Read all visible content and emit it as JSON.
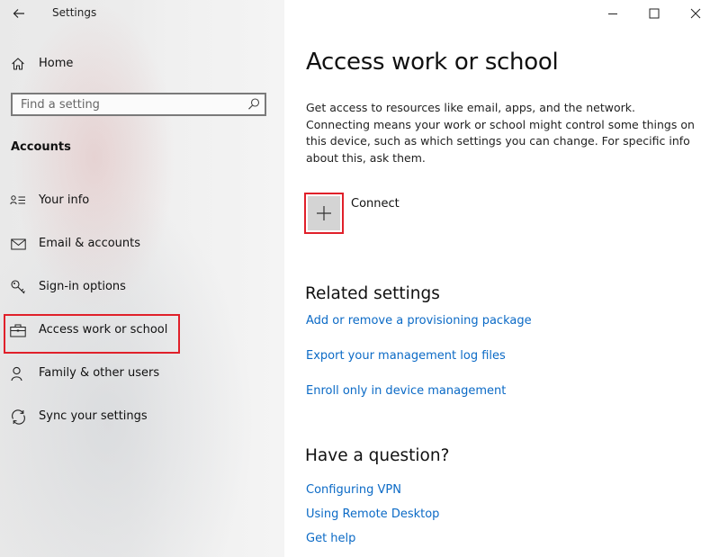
{
  "window": {
    "title": "Settings",
    "controls": {
      "minimize_icon": "minimize-icon",
      "maximize_icon": "maximize-icon",
      "close_icon": "close-icon"
    }
  },
  "sidebar": {
    "home_label": "Home",
    "search": {
      "placeholder": "Find a setting",
      "value": ""
    },
    "section_heading": "Accounts",
    "items": [
      {
        "label": "Your info",
        "icon": "person-card-icon"
      },
      {
        "label": "Email & accounts",
        "icon": "mail-icon"
      },
      {
        "label": "Sign-in options",
        "icon": "key-icon"
      },
      {
        "label": "Access work or school",
        "icon": "briefcase-icon",
        "selected": true
      },
      {
        "label": "Family & other users",
        "icon": "person-add-icon"
      },
      {
        "label": "Sync your settings",
        "icon": "sync-icon"
      }
    ]
  },
  "main": {
    "title": "Access work or school",
    "description": "Get access to resources like email, apps, and the network. Connecting means your work or school might control some things on this device, such as which settings you can change. For specific info about this, ask them.",
    "connect_label": "Connect",
    "related": {
      "heading": "Related settings",
      "links": [
        "Add or remove a provisioning package",
        "Export your management log files",
        "Enroll only in device management"
      ]
    },
    "question": {
      "heading": "Have a question?",
      "links": [
        "Configuring VPN",
        "Using Remote Desktop",
        "Get help"
      ]
    }
  },
  "colors": {
    "link": "#0b6ac6",
    "highlight": "#e0202a",
    "tile": "#d4d4d4"
  }
}
